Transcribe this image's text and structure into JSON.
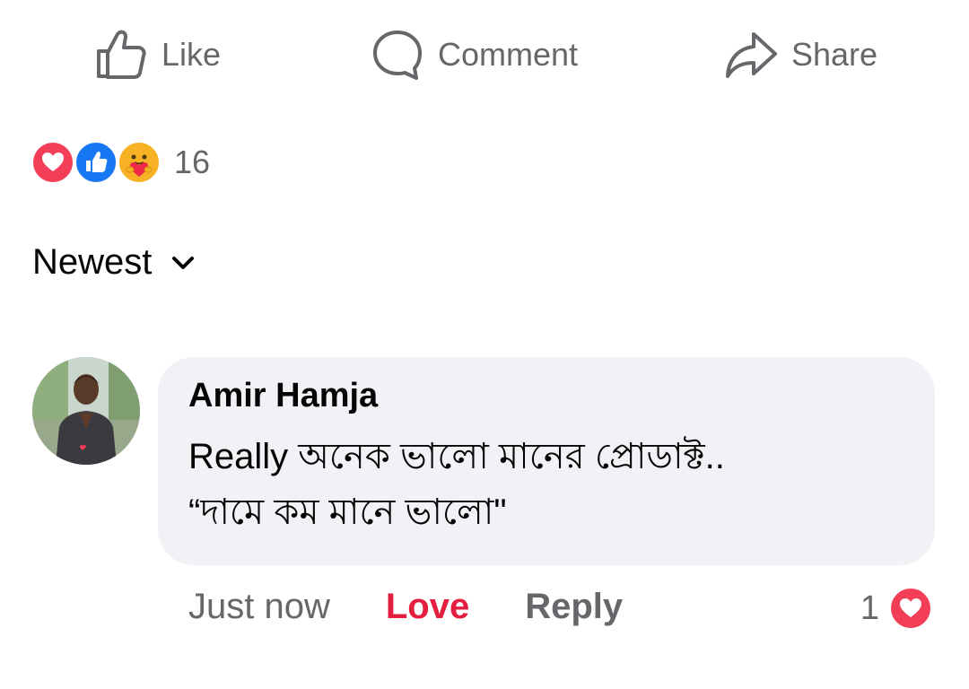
{
  "actions": {
    "like_label": "Like",
    "comment_label": "Comment",
    "share_label": "Share"
  },
  "reactions": {
    "types": [
      "love-reaction-icon",
      "like-reaction-icon",
      "care-reaction-icon"
    ],
    "count": "16"
  },
  "sort": {
    "label": "Newest"
  },
  "comment": {
    "author": "Amir Hamja",
    "text": "Really অনেক ভালো মানের প্রোডাক্ট..\n“দামে কম মানে ভালো\"",
    "time": "Just now",
    "love_label": "Love",
    "reply_label": "Reply",
    "reaction_count": "1",
    "reaction_type": "love-reaction-icon"
  },
  "colors": {
    "muted_text": "#65676b",
    "love_red": "#e41e3f",
    "like_blue": "#1877f2",
    "care_yellow": "#f7b125",
    "bubble_bg": "#f0f2f5"
  }
}
